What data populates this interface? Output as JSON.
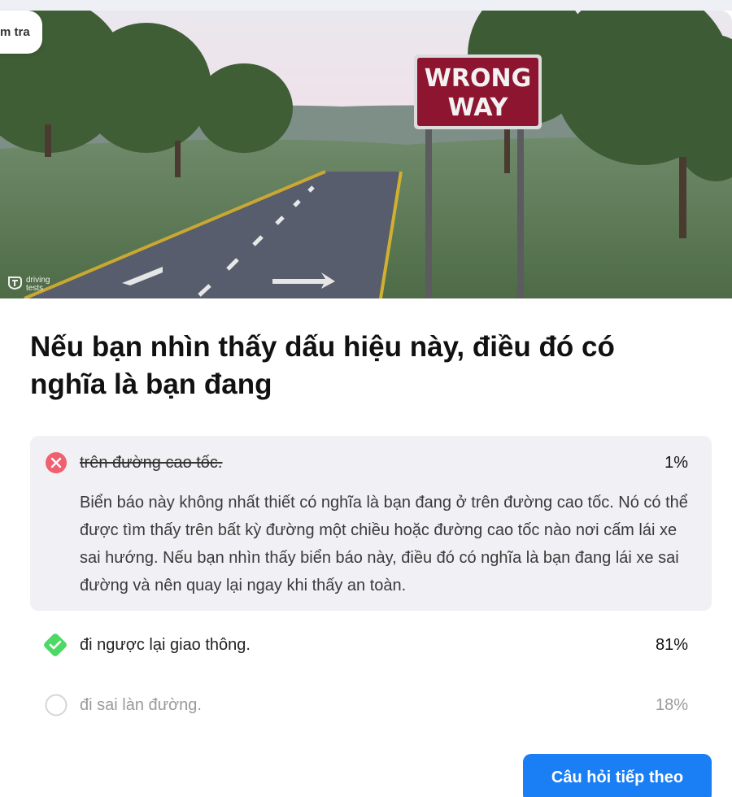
{
  "top_pill": {
    "label": "m tra"
  },
  "hero": {
    "sign_line1": "WRONG",
    "sign_line2": "WAY",
    "watermark_line1": "driving",
    "watermark_line2": "tests"
  },
  "question": {
    "text": "Nếu bạn nhìn thấy dấu hiệu này, điều đó có nghĩa là bạn đang"
  },
  "answers": [
    {
      "text": "trên đường cao tốc.",
      "percent": "1%",
      "state": "wrong",
      "explanation": "Biển báo này không nhất thiết có nghĩa là bạn đang ở trên đường cao tốc. Nó có thể được tìm thấy trên bất kỳ đường một chiều hoặc đường cao tốc nào nơi cấm lái xe sai hướng. Nếu bạn nhìn thấy biển báo này, điều đó có nghĩa là bạn đang lái xe sai đường và nên quay lại ngay khi thấy an toàn."
    },
    {
      "text": "đi ngược lại giao thông.",
      "percent": "81%",
      "state": "correct"
    },
    {
      "text": "đi sai làn đường.",
      "percent": "18%",
      "state": "unselected"
    }
  ],
  "next_button": {
    "label": "Câu hỏi tiếp theo"
  },
  "colors": {
    "wrong": "#f0606e",
    "correct": "#4cd964",
    "accent": "#1a7ef5",
    "sign_red": "#8e1530"
  }
}
